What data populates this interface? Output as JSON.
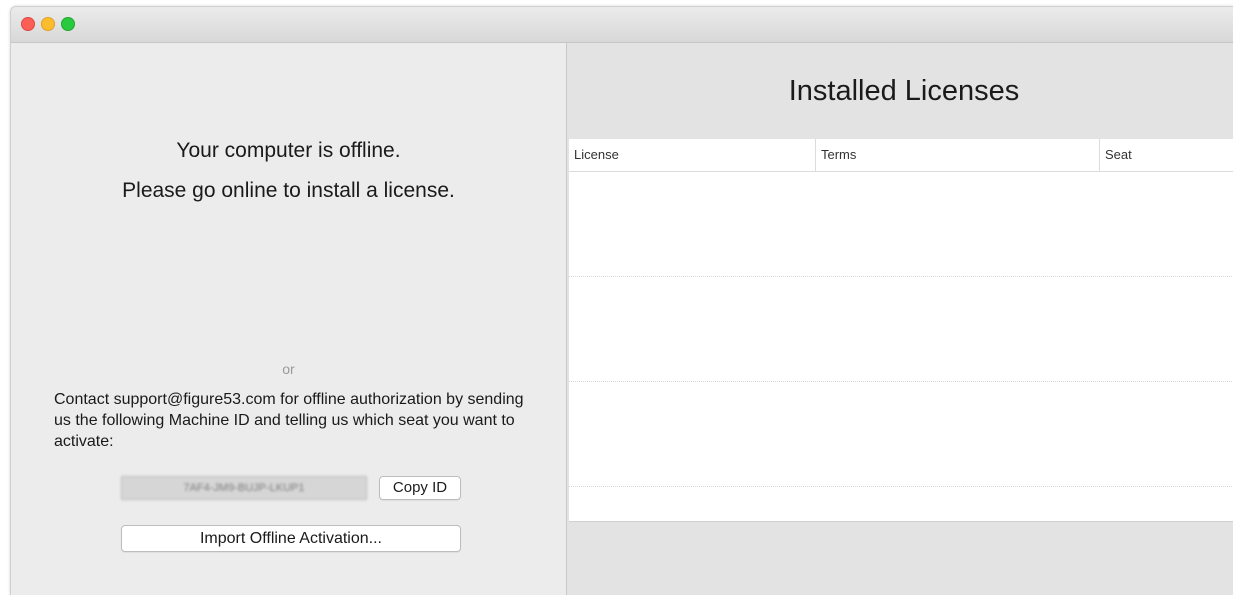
{
  "window": {
    "buttons": {
      "close_color": "#fc5f57",
      "minimize_color": "#fdbc2e",
      "zoom_color": "#29c940"
    }
  },
  "left_pane": {
    "offline_line1": "Your computer is offline.",
    "offline_line2": "Please go online to install a license.",
    "or_text": "or",
    "contact_text": "Contact support@figure53.com for offline authorization by sending us the following Machine ID and telling us which seat you want to activate:",
    "machine_id": "7AF4-JM9-BUJP-LKUP1",
    "copy_id_label": "Copy ID",
    "import_label": "Import Offline Activation..."
  },
  "right_pane": {
    "title": "Installed Licenses",
    "table": {
      "columns": [
        "License",
        "Terms",
        "Seat"
      ],
      "rows": [
        [
          "",
          "",
          ""
        ],
        [
          "",
          "",
          ""
        ],
        [
          "",
          "",
          ""
        ],
        [
          "",
          "",
          ""
        ]
      ]
    }
  }
}
